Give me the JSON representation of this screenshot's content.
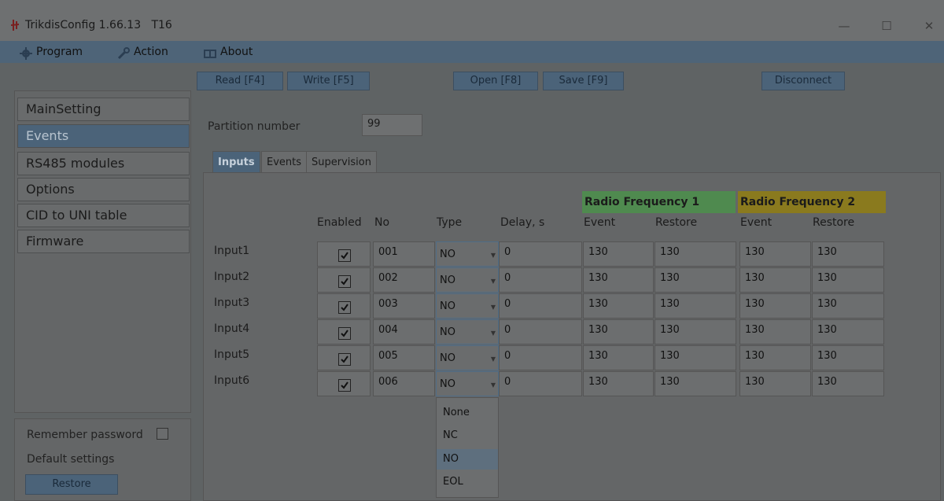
{
  "window": {
    "title": "TrikdisConfig 1.66.13   T16",
    "minimize": "—",
    "maximize": "☐",
    "close": "✕"
  },
  "menu": {
    "program": "Program",
    "action": "Action",
    "about": "About"
  },
  "toolbar": {
    "read": "Read [F4]",
    "write": "Write [F5]",
    "open": "Open [F8]",
    "save": "Save [F9]",
    "disconnect": "Disconnect"
  },
  "sidebar": {
    "items": [
      {
        "label": "MainSetting"
      },
      {
        "label": "Events"
      },
      {
        "label": "RS485 modules"
      },
      {
        "label": "Options"
      },
      {
        "label": "CID to UNI table"
      },
      {
        "label": "Firmware"
      }
    ],
    "active_index": 1,
    "remember_password": "Remember password",
    "default_settings": "Default settings",
    "restore": "Restore"
  },
  "main": {
    "partition_label": "Partition number",
    "partition_value": "99",
    "tabs": [
      {
        "label": "Inputs"
      },
      {
        "label": "Events"
      },
      {
        "label": "Supervision"
      }
    ],
    "active_tab": 0,
    "rf1": "Radio Frequency 1",
    "rf2": "Radio Frequency 2",
    "rf1_color": "#4f8a4f",
    "rf2_color": "#8a7a1e",
    "headers": {
      "enabled": "Enabled",
      "no": "No",
      "type": "Type",
      "delay": "Delay, s",
      "rf1_event": "Event",
      "rf1_restore": "Restore",
      "rf2_event": "Event",
      "rf2_restore": "Restore"
    },
    "rows": [
      {
        "label": "Input1",
        "enabled": true,
        "no": "001",
        "type": "NO",
        "delay": "0",
        "rf1_event": "130",
        "rf1_restore": "130",
        "rf2_event": "130",
        "rf2_restore": "130"
      },
      {
        "label": "Input2",
        "enabled": true,
        "no": "002",
        "type": "NO",
        "delay": "0",
        "rf1_event": "130",
        "rf1_restore": "130",
        "rf2_event": "130",
        "rf2_restore": "130"
      },
      {
        "label": "Input3",
        "enabled": true,
        "no": "003",
        "type": "NO",
        "delay": "0",
        "rf1_event": "130",
        "rf1_restore": "130",
        "rf2_event": "130",
        "rf2_restore": "130"
      },
      {
        "label": "Input4",
        "enabled": true,
        "no": "004",
        "type": "NO",
        "delay": "0",
        "rf1_event": "130",
        "rf1_restore": "130",
        "rf2_event": "130",
        "rf2_restore": "130"
      },
      {
        "label": "Input5",
        "enabled": true,
        "no": "005",
        "type": "NO",
        "delay": "0",
        "rf1_event": "130",
        "rf1_restore": "130",
        "rf2_event": "130",
        "rf2_restore": "130"
      },
      {
        "label": "Input6",
        "enabled": true,
        "no": "006",
        "type": "NO",
        "delay": "0",
        "rf1_event": "130",
        "rf1_restore": "130",
        "rf2_event": "130",
        "rf2_restore": "130"
      }
    ],
    "type_options": [
      "None",
      "NC",
      "NO",
      "EOL"
    ],
    "type_selected": "NO"
  }
}
